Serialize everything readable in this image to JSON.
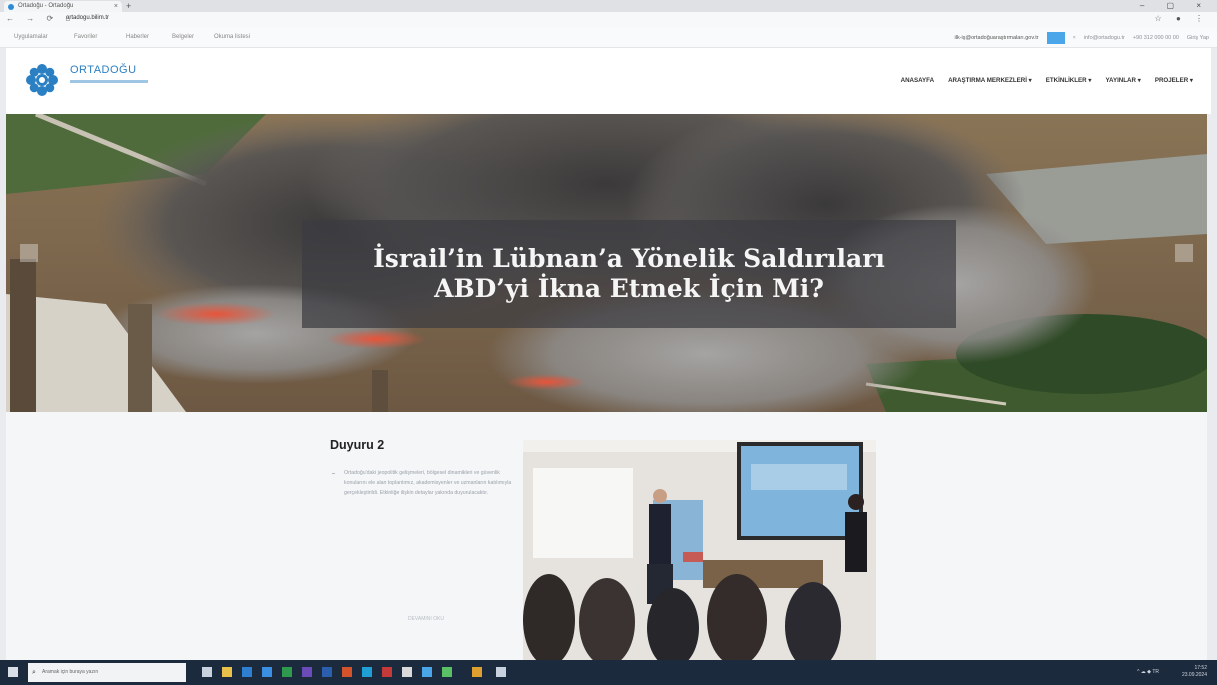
{
  "browser": {
    "tab_title": "Ortadoğu - Ortadoğu",
    "tab_close": "×",
    "new_tab": "+",
    "window_controls": "– ▢ ×",
    "nav_buttons": "← → ⟳ ⌂",
    "url": "ortadogu.bilim.tr",
    "toolbar_right": "☆ ● ⋮"
  },
  "bookmarks": [
    "Uygulamalar",
    "Favoriler",
    "Haberler",
    "Belgeler",
    "Okuma listesi"
  ],
  "topbar": {
    "email": "ilk-iş@ortadoğuaraştırmaları.gov.tr",
    "links": [
      "info@ortadogu.tr",
      "+90 312 000 00 00",
      "Giriş Yap"
    ],
    "close": "×"
  },
  "site": {
    "logo_text": "ORTADOĞU",
    "nav": [
      "ANASAYFA",
      "ARAŞTIRMA MERKEZLERİ ▾",
      "ETKİNLİKLER ▾",
      "YAYINLAR ▾",
      "PROJELER ▾"
    ]
  },
  "hero": {
    "title_line1": "İsrail’in Lübnan’a Yönelik Saldırıları",
    "title_line2": "ABD’yi İkna Etmek İçin Mi?"
  },
  "announcement": {
    "title": "Duyuru 2",
    "body": "Ortadoğu'daki jeopolitik gelişmeleri, bölgesel dinamikleri ve güvenlik konularını ele alan toplantımız, akademisyenler ve uzmanların katılımıyla gerçekleştirildi. Etkinliğe ilişkin detaylar yakında duyurulacaktır.",
    "more_label": "DEVAMINI OKU"
  },
  "taskbar": {
    "search_placeholder": "Aramak için buraya yazın",
    "tray_status": "^ ☁ ◆ TR",
    "time": "17:52",
    "date": "23.09.2024"
  },
  "colors": {
    "brand_blue": "#2b7fc3",
    "taskbar": "#1c2a3e",
    "caption_bg": "#3c3c41"
  }
}
